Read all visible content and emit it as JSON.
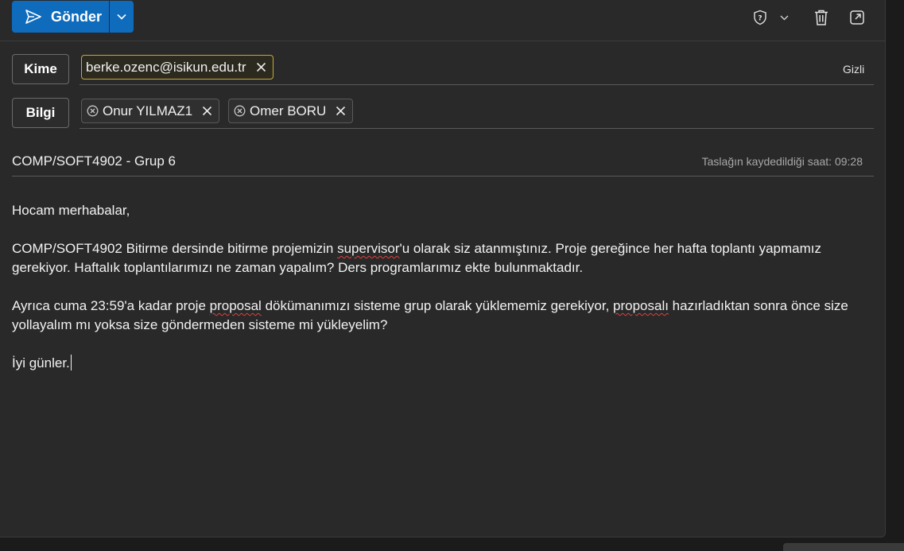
{
  "toolbar": {
    "send_label": "Gönder",
    "icons": [
      "send-icon",
      "chevron-down-icon",
      "shield-question-icon",
      "chevron-down-icon",
      "trash-icon",
      "pop-out-icon"
    ]
  },
  "recipients": {
    "to_label": "Kime",
    "to": [
      {
        "address": "berke.ozenc@isikun.edu.tr"
      }
    ],
    "bcc_label": "Gizli",
    "cc_label": "Bilgi",
    "cc": [
      {
        "name": "Onur YILMAZ1"
      },
      {
        "name": "Omer BORU"
      }
    ]
  },
  "subject": {
    "text": "COMP/SOFT4902 - Grup 6",
    "draft_saved": "Taslağın kaydedildiği saat: 09:28"
  },
  "body": {
    "greeting": "Hocam merhabalar,",
    "p1_a": "COMP/SOFT4902 Bitirme dersinde bitirme projemizin ",
    "p1_sp": "supervisor",
    "p1_b": "'u olarak siz atanmıştınız. Proje gereğince her hafta toplantı yapmamız gerekiyor. Haftalık toplantılarımızı ne zaman yapalım? Ders programlarımız ekte bulunmaktadır.",
    "p2_a": "Ayrıca cuma 23:59'a kadar proje ",
    "p2_sp1": "proposal",
    "p2_b": " dökümanımızı sisteme grup olarak yüklememiz gerekiyor, ",
    "p2_sp2": "proposalı",
    "p2_c": " hazırladıktan sonra önce size yollayalım mı yoksa size göndermeden sisteme mi yükleyelim?",
    "closing": "İyi günler."
  },
  "colors": {
    "accent": "#0f6cbd",
    "background": "#292929",
    "chip_highlight_border": "#c7a63a",
    "spelling_error": "#e04040"
  }
}
